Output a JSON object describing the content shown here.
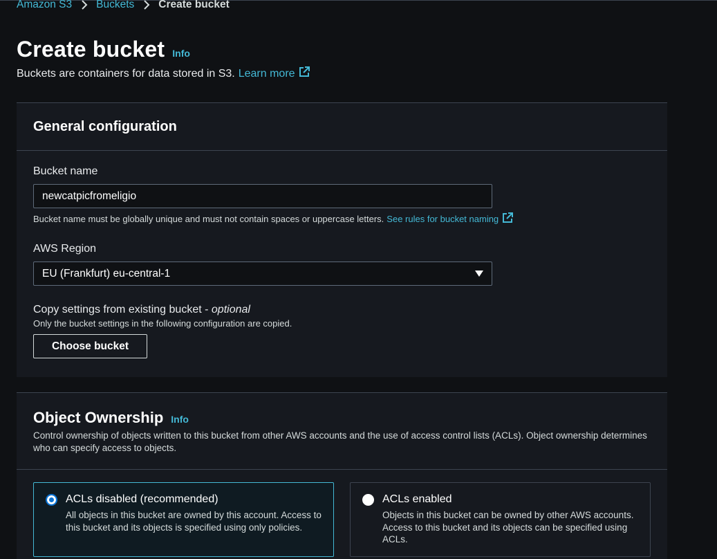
{
  "breadcrumb": {
    "items": [
      {
        "label": "Amazon S3"
      },
      {
        "label": "Buckets"
      }
    ],
    "current": "Create bucket"
  },
  "header": {
    "title": "Create bucket",
    "info": "Info",
    "description": "Buckets are containers for data stored in S3.",
    "learn_more": "Learn more"
  },
  "general": {
    "title": "General configuration",
    "bucket_name": {
      "label": "Bucket name",
      "value": "newcatpicfromeligio",
      "hint": "Bucket name must be globally unique and must not contain spaces or uppercase letters.",
      "rules_link": "See rules for bucket naming"
    },
    "region": {
      "label": "AWS Region",
      "value": "EU (Frankfurt) eu-central-1"
    },
    "copy": {
      "label": "Copy settings from existing bucket - ",
      "optional": "optional",
      "hint": "Only the bucket settings in the following configuration are copied.",
      "button": "Choose bucket"
    }
  },
  "ownership": {
    "title": "Object Ownership",
    "info": "Info",
    "description": "Control ownership of objects written to this bucket from other AWS accounts and the use of access control lists (ACLs). Object ownership determines who can specify access to objects.",
    "options": [
      {
        "label": "ACLs disabled (recommended)",
        "description": "All objects in this bucket are owned by this account. Access to this bucket and its objects is specified using only policies.",
        "selected": true
      },
      {
        "label": "ACLs enabled",
        "description": "Objects in this bucket can be owned by other AWS accounts. Access to this bucket and its objects can be specified using ACLs.",
        "selected": false
      }
    ]
  },
  "colors": {
    "background": "#0f1114",
    "panel": "#16191f",
    "link": "#44b9d6",
    "radio_selected": "#0972d3"
  }
}
